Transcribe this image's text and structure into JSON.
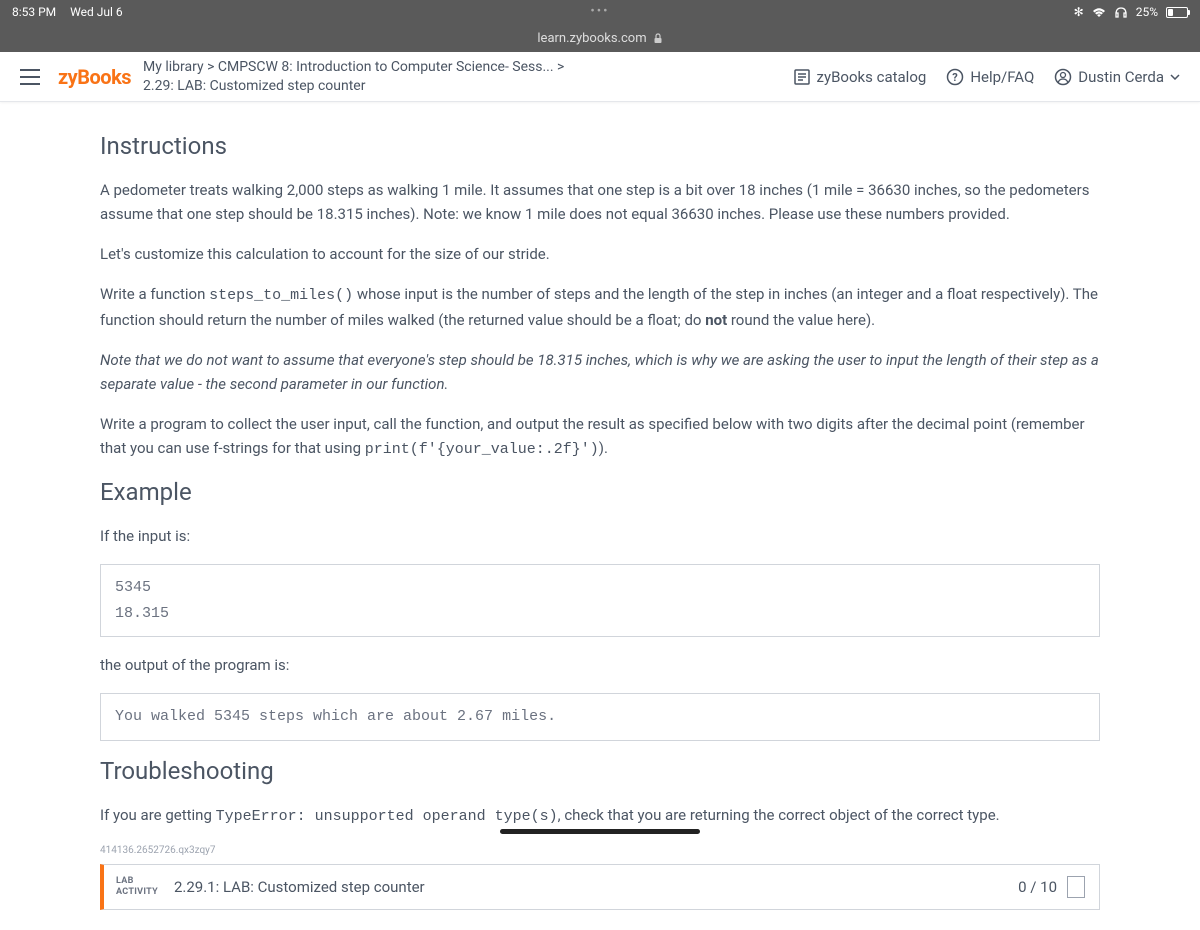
{
  "status": {
    "time": "8:53 PM",
    "date": "Wed Jul 6",
    "battery": "25%"
  },
  "browser": {
    "url": "learn.zybooks.com"
  },
  "nav": {
    "logo": "zyBooks",
    "breadcrumb_line1": "My library > CMPSCW 8: Introduction to Computer Science- Sess... >",
    "breadcrumb_line2": "2.29: LAB: Customized step counter",
    "catalog": "zyBooks catalog",
    "help": "Help/FAQ",
    "user": "Dustin Cerda"
  },
  "sections": {
    "instructions_heading": "Instructions",
    "p1": "A pedometer treats walking 2,000 steps as walking 1 mile. It assumes that one step is a bit over 18 inches (1 mile = 36630 inches, so the pedometers assume that one step should be 18.315 inches). Note: we know 1 mile does not equal 36630 inches. Please use these numbers provided.",
    "p2": "Let's customize this calculation to account for the size of our stride.",
    "p3a": "Write a function ",
    "p3_code": "steps_to_miles()",
    "p3b": " whose input is the number of steps and the length of the step in inches (an integer and a float respectively). The function should return the number of miles walked (the returned value should be a ",
    "p3c": "float",
    "p3d": "; do ",
    "p3e": "not",
    "p3f": " round the value here).",
    "p4": "Note that we do not want to assume that everyone's step should be 18.315 inches, which is why we are asking the user to input the length of their step as a separate value - the second parameter in our function.",
    "p5a": "Write a program to collect the user input, call the function, and output the result as specified below with two digits after the decimal point (remember that you can use f-strings for that using ",
    "p5_code": "print(f'{your_value:.2f}')",
    "p5b": ").",
    "example_heading": "Example",
    "example_intro": "If the input is:",
    "example_input": "5345\n18.315",
    "example_output_intro": "the output of the program is:",
    "example_output": "You walked 5345 steps which are about 2.67 miles.",
    "troubleshooting_heading": "Troubleshooting",
    "ts_a": "If you are getting ",
    "ts_code": "TypeError: unsupported operand type(s)",
    "ts_b": ", check that you are returning the correct object of the correct type.",
    "hash": "414136.2652726.qx3zqy7"
  },
  "lab": {
    "label1": "LAB",
    "label2": "ACTIVITY",
    "title": "2.29.1: LAB: Customized step counter",
    "score": "0 / 10"
  }
}
